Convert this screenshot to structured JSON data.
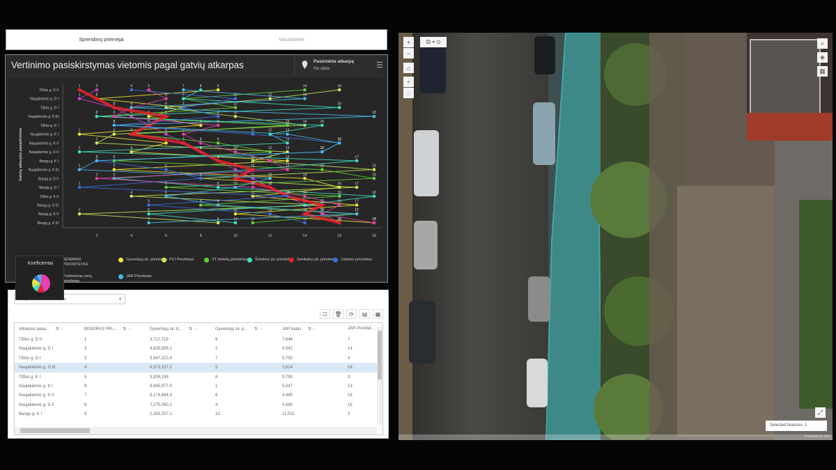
{
  "tabs": [
    {
      "label": "Sprendimų priėmėjai",
      "active": true
    },
    {
      "label": "Visuomenei",
      "active": false
    }
  ],
  "chart_panel": {
    "title": "Vertinimo pasiskirstymas vietomis pagal gatvių atkarpas",
    "selector_label": "Pasirinkite atkarpą",
    "selector_value": "No data",
    "pie_title": "Koeficientai"
  },
  "chart_data": {
    "type": "line",
    "ylabel": "Gatvių atkarpos pavadinimas",
    "x_ticks": [
      2,
      4,
      6,
      8,
      10,
      12,
      14,
      16,
      18
    ],
    "xlim": [
      1,
      18
    ],
    "categories": [
      "Tilžės g. D II",
      "Naujakiemio g. D I",
      "Tilžės g. D I",
      "Naujakiemio g. D III",
      "Tilžės g. K I",
      "Naujakiemio g. K I",
      "Naujakiemio g. K II",
      "Naujakiemio g. D II",
      "Bangų g. K I",
      "Naujakiemio g. K III",
      "Bangų g. D II",
      "Bangų g. D I",
      "Tilžės g. K II",
      "Bangų g. D III",
      "Bangų g. K II",
      "Bangų g. K III"
    ],
    "series": [
      {
        "name": "BENDRAS PRIORITETAS",
        "color": "#c93fd9",
        "values": [
          2,
          1,
          3,
          4,
          5,
          6,
          7,
          8,
          9,
          10,
          11,
          12,
          13,
          14,
          15,
          16
        ]
      },
      {
        "name": "Gyventojų sk. prioritetas",
        "color": "#f3e53a",
        "values": [
          9,
          2,
          7,
          5,
          8,
          1,
          6,
          4,
          13,
          3,
          14,
          16,
          11,
          17,
          10,
          18
        ]
      },
      {
        "name": "PCI Prioritetas",
        "color": "#c6e85c",
        "values": [
          16,
          12,
          6,
          10,
          14,
          3,
          2,
          13,
          11,
          18,
          8,
          17,
          4,
          15,
          1,
          9
        ]
      },
      {
        "name": "VT stotelių prioritetas",
        "color": "#5fd03b",
        "values": [
          14,
          7,
          10,
          2,
          13,
          4,
          9,
          12,
          3,
          15,
          18,
          6,
          16,
          8,
          17,
          11
        ]
      },
      {
        "name": "Švietimo įst. prioritetas",
        "color": "#3fe0c2",
        "values": [
          8,
          7,
          16,
          2,
          15,
          12,
          13,
          1,
          17,
          11,
          3,
          9,
          18,
          14,
          5,
          10
        ]
      },
      {
        "name": "Sveikatos įst. prioritetas",
        "color": "#e8222a",
        "values": [
          1,
          2,
          3,
          6,
          5,
          4,
          7,
          8,
          9,
          11,
          10,
          12,
          13,
          15,
          14,
          16
        ]
      },
      {
        "name": "Judumo prioritetas",
        "color": "#3a6fe0",
        "values": [
          4,
          10,
          7,
          9,
          3,
          11,
          16,
          15,
          2,
          6,
          8,
          1,
          13,
          5,
          12,
          14
        ]
      },
      {
        "name": "Probleminių vietų prioritetas",
        "color": "#e040a8",
        "values": [
          5,
          6,
          4,
          3,
          9,
          7,
          8,
          10,
          12,
          13,
          2,
          11,
          14,
          16,
          15,
          18
        ]
      },
      {
        "name": "JAR Prioritetas",
        "color": "#4ab8e8",
        "values": [
          7,
          14,
          4,
          18,
          3,
          13,
          16,
          15,
          2,
          1,
          12,
          10,
          6,
          9,
          17,
          5
        ]
      }
    ],
    "pie": [
      {
        "color": "#e83fb5",
        "value": 45
      },
      {
        "color": "#e8222a",
        "value": 12
      },
      {
        "color": "#3fe0c2",
        "value": 10
      },
      {
        "color": "#c6e85c",
        "value": 9
      },
      {
        "color": "#f3e53a",
        "value": 8
      },
      {
        "color": "#3a6fe0",
        "value": 8
      },
      {
        "color": "#4ab8e8",
        "value": 8
      }
    ]
  },
  "table": {
    "dropdown": "Šaligatvių būklės vertinimas",
    "columns": [
      "Atkarpos pava...",
      "BENDRAS PRI...",
      "Gyventojų sk. b...",
      "Gyventojų sk. p...",
      "JAR balas",
      "JAR Prioritet..."
    ],
    "rows": [
      [
        "Tilžės g. D II",
        "1",
        "3,717,719",
        "9",
        "7,644",
        "7"
      ],
      [
        "Naujakiemio g. D I",
        "2",
        "9,828,599.1",
        "2",
        "5,042",
        "14"
      ],
      [
        "Tilžės g. D I",
        "3",
        "3,947,322.4",
        "7",
        "9,750",
        "4"
      ],
      [
        "Naujakiemio g. D III",
        "4",
        "6,573,157.2",
        "5",
        "3,814",
        "18"
      ],
      [
        "Tilžės g. K I",
        "5",
        "3,926,199",
        "8",
        "9,790",
        "3"
      ],
      [
        "Naujakiemio g. K I",
        "6",
        "9,945,977.4",
        "1",
        "5,047",
        "13"
      ],
      [
        "Naujakiemio g. K II",
        "7",
        "6,174,684.3",
        "6",
        "4,485",
        "16"
      ],
      [
        "Naujakiemio g. D II",
        "8",
        "7,275,060.1",
        "4",
        "4,580",
        "15"
      ],
      [
        "Bangų g. K I",
        "9",
        "2,343,257.1",
        "13",
        "11,511",
        "2"
      ]
    ],
    "selected_row": 3
  },
  "map": {
    "selected_features": "Selected features: 1",
    "attribution": "Powered by Esri"
  }
}
